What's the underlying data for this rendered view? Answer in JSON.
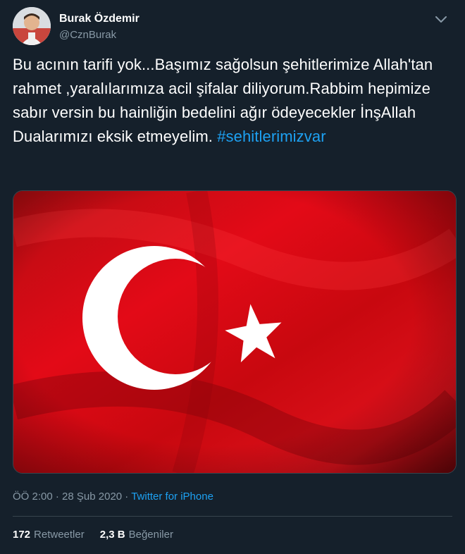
{
  "user": {
    "name": "Burak Özdemir",
    "handle": "@CznBurak"
  },
  "tweet": {
    "text": "Bu acının tarifi yok...Başımız sağolsun şehitlerimize Allah'tan rahmet ,yaralılarımıza acil şifalar diliyorum.Rabbim hepimize sabır versin bu hainliğin bedelini ağır ödeyecekler İnşAllah Dualarımızı eksik etmeyelim.",
    "hashtag": "#sehitlerimizvar"
  },
  "meta": {
    "time": "ÖÖ 2:00",
    "separator": "·",
    "date": "28 Şub 2020",
    "source": "Twitter for iPhone"
  },
  "stats": {
    "retweets_count": "172",
    "retweets_label": "Retweetler",
    "likes_count": "2,3 B",
    "likes_label": "Beğeniler"
  },
  "icons": {
    "more": "chevron-down-icon",
    "flag": "turkish-flag-image"
  },
  "colors": {
    "background": "#15202b",
    "accent": "#1da1f2",
    "secondary_text": "#8899a6",
    "flag_red": "#e30a17"
  }
}
